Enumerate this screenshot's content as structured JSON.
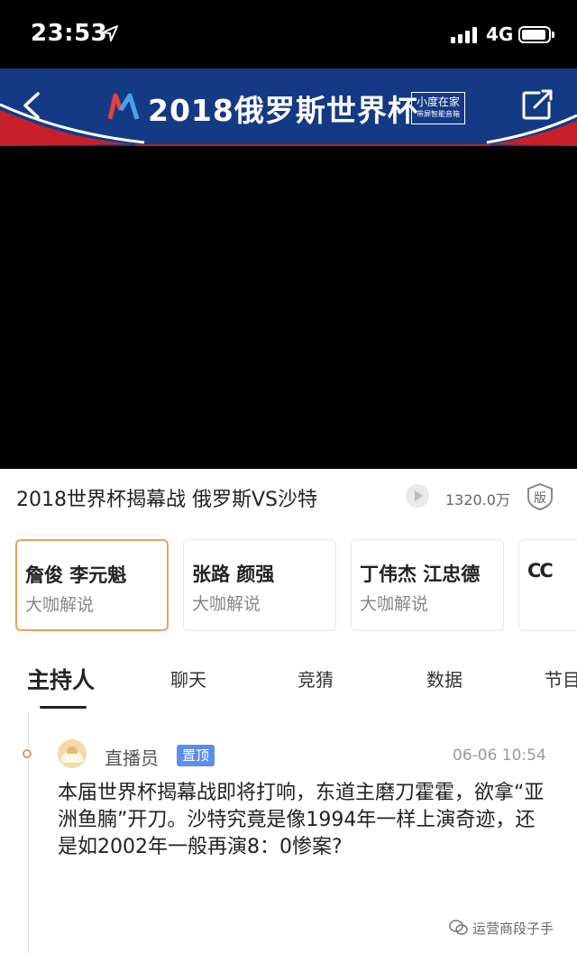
{
  "status_bar": {
    "time": "23:53",
    "network": "4G"
  },
  "header": {
    "title": "2018俄罗斯世界杯",
    "partner_line1": "小度在家",
    "partner_line2": "带屏智能音箱",
    "colors": {
      "banner": "#143a86",
      "stripe_red": "#c8202a"
    }
  },
  "match": {
    "title": "2018世界杯揭幕战 俄罗斯VS沙特",
    "views": "1320.0万",
    "badge": "版"
  },
  "commentators": [
    {
      "names": "詹俊 李元魁",
      "subtitle": "大咖解说",
      "selected": true
    },
    {
      "names": "张路 颜强",
      "subtitle": "大咖解说",
      "selected": false
    },
    {
      "names": "丁伟杰 江忠德",
      "subtitle": "大咖解说",
      "selected": false
    },
    {
      "names": "CC",
      "subtitle": "",
      "selected": false
    }
  ],
  "tabs": [
    "主持人",
    "聊天",
    "竞猜",
    "数据",
    "节目"
  ],
  "feed": [
    {
      "author": "直播员",
      "badge": "置顶",
      "time": "06-06 10:54",
      "text": "本届世界杯揭幕战即将打响，东道主磨刀霍霍，欲拿“亚洲鱼腩”开刀。沙特究竟是像1994年一样上演奇迹，还是如2002年一般再演8：0惨案?"
    }
  ],
  "watermark": "运营商段子手"
}
